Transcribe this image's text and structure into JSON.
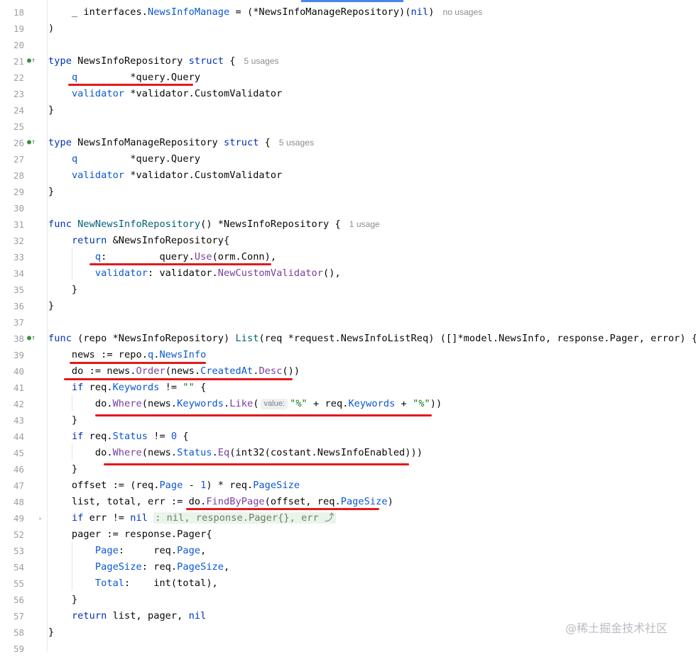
{
  "editor": {
    "lines": [
      {
        "n": "18",
        "code": "    _ interfaces.<fld>NewsInfoManage</fld> = (*NewsInfoManageRepository)(<kw>nil</kw>)",
        "hint": "no usages"
      },
      {
        "n": "19",
        "code": ")"
      },
      {
        "n": "20",
        "code": ""
      },
      {
        "n": "21",
        "code": "<kw>type</kw> NewsInfoRepository <kw>struct</kw> {",
        "hint": "5 usages",
        "mark": true
      },
      {
        "n": "22",
        "code": "    <fld>q</fld>         *query.Query"
      },
      {
        "n": "23",
        "code": "    <fld>validator</fld> *validator.CustomValidator"
      },
      {
        "n": "24",
        "code": "}"
      },
      {
        "n": "25",
        "code": ""
      },
      {
        "n": "26",
        "code": "<kw>type</kw> NewsInfoManageRepository <kw>struct</kw> {",
        "hint": "5 usages",
        "mark": true
      },
      {
        "n": "27",
        "code": "    <fld>q</fld>         *query.Query"
      },
      {
        "n": "28",
        "code": "    <fld>validator</fld> *validator.CustomValidator"
      },
      {
        "n": "29",
        "code": "}"
      },
      {
        "n": "30",
        "code": ""
      },
      {
        "n": "31",
        "code": "<kw>func</kw> <fn>NewNewsInfoRepository</fn>() *NewsInfoRepository {",
        "hint": "1 usage"
      },
      {
        "n": "32",
        "code": "    <kw>return</kw> &NewsInfoRepository{"
      },
      {
        "n": "33",
        "code": "        <fld>q</fld>:         query.<mth>Use</mth>(orm.Conn),"
      },
      {
        "n": "34",
        "code": "        <fld>validator</fld>: validator.<mth>NewCustomValidator</mth>(),"
      },
      {
        "n": "35",
        "code": "    }"
      },
      {
        "n": "36",
        "code": "}"
      },
      {
        "n": "37",
        "code": ""
      },
      {
        "n": "38",
        "code": "<kw>func</kw> (repo *NewsInfoRepository) <fn>List</fn>(req *request.NewsInfoListReq) ([]*model.NewsInfo, response.Pager, error) {",
        "mark": true
      },
      {
        "n": "39",
        "code": "    news := repo.<fld>q</fld>.<fld>NewsInfo</fld>"
      },
      {
        "n": "40",
        "code": "    do := news.<mth>Order</mth>(news.<fld>CreatedAt</fld>.<mth>Desc</mth>())"
      },
      {
        "n": "41",
        "code": "    <kw>if</kw> req.<fld>Keywords</fld> != <str>\"\"</str> {"
      },
      {
        "n": "42",
        "code": "        do.<mth>Where</mth>(news.<fld>Keywords</fld>.<mth>Like</mth>(<param>value:</param><str>\"%\"</str> + req.<fld>Keywords</fld> + <str>\"%\"</str>))"
      },
      {
        "n": "43",
        "code": "    }"
      },
      {
        "n": "44",
        "code": "    <kw>if</kw> req.<fld>Status</fld> != <num>0</num> {"
      },
      {
        "n": "45",
        "code": "        do.<mth>Where</mth>(news.<fld>Status</fld>.<mth>Eq</mth>(int32(costant.NewsInfoEnabled)))"
      },
      {
        "n": "46",
        "code": "    }"
      },
      {
        "n": "47",
        "code": "    offset := (req.<fld>Page</fld> - <num>1</num>) * req.<fld>PageSize</fld>"
      },
      {
        "n": "48",
        "code": "    list, total, err := do.<mth>FindByPage</mth>(offset, req.<fld>PageSize</fld>)"
      },
      {
        "n": "49",
        "code": "    <kw>if</kw> err != <kw>nil</kw> <folded>: nil, response.Pager{}, err ⤴</folded>",
        "fold": true
      },
      {
        "n": "52",
        "code": "    pager := response.Pager{"
      },
      {
        "n": "53",
        "code": "        <fld>Page</fld>:     req.<fld>Page</fld>,"
      },
      {
        "n": "54",
        "code": "        <fld>PageSize</fld>: req.<fld>PageSize</fld>,"
      },
      {
        "n": "55",
        "code": "        <fld>Total</fld>:    int(total),"
      },
      {
        "n": "56",
        "code": "    }"
      },
      {
        "n": "57",
        "code": "    <kw>return</kw> list, pager, <kw>nil</kw>"
      },
      {
        "n": "58",
        "code": "}"
      },
      {
        "n": "59",
        "code": ""
      }
    ]
  },
  "gutter_mark_icon": "implementation-marker-icon",
  "watermark": "@稀土掘金技术社区",
  "colors": {
    "underline": "#e3191b",
    "keyword": "#0033b3",
    "field": "#0b57d0",
    "method": "#7a3e9d",
    "string": "#067d17"
  }
}
